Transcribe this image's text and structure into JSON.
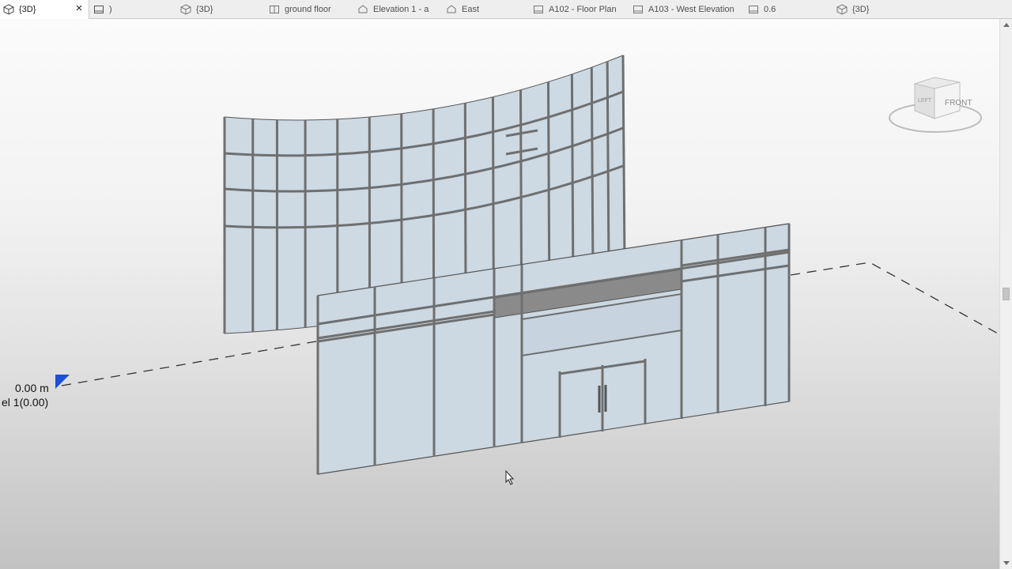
{
  "tabs": [
    {
      "label": "{3D}",
      "icon": "3d-view-icon",
      "active": true
    },
    {
      "label": ")",
      "icon": "sheet-icon",
      "active": false
    },
    {
      "label": "{3D}",
      "icon": "3d-view-icon",
      "active": false
    },
    {
      "label": "ground floor",
      "icon": "floor-plan-icon",
      "active": false
    },
    {
      "label": "Elevation 1 - a",
      "icon": "elevation-icon",
      "active": false
    },
    {
      "label": "East",
      "icon": "elevation-icon",
      "active": false
    },
    {
      "label": "A102 - Floor Plan",
      "icon": "sheet-icon",
      "active": false
    },
    {
      "label": "A103 - West Elevation",
      "icon": "sheet-icon",
      "active": false
    },
    {
      "label": "0.6",
      "icon": "sheet-icon",
      "active": false
    },
    {
      "label": "{3D}",
      "icon": "3d-view-icon",
      "active": false
    }
  ],
  "close_label": "×",
  "level": {
    "elevation": "0.00 m",
    "name": "el 1(0.00)",
    "color": "#1a4fd6"
  },
  "viewcube": {
    "face_front": "FRONT",
    "face_left": "LEFT"
  },
  "colors": {
    "glass": "#cdd9e3",
    "mullion": "#7a7a7a",
    "spandrel": "#8c8c8c",
    "level_marker": "#1a4fd6"
  }
}
